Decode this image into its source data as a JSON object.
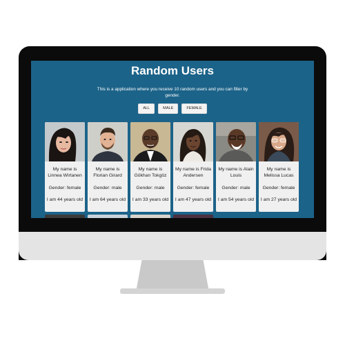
{
  "app": {
    "title": "Random Users",
    "subtitle": "This is a application where you receive 10 random users and you can filter by gender."
  },
  "filters": [
    "ALL",
    "MALE",
    "FEMALE"
  ],
  "users": [
    {
      "name": "My name is Linnea Wirtanen",
      "gender": "Gender: female",
      "age": "I am 44 years old",
      "avatar": "female-avatar"
    },
    {
      "name": "My name is Florian Girard",
      "gender": "Gender: male",
      "age": "I am 64 years old",
      "avatar": "male-avatar"
    },
    {
      "name": "My name is Gökhan Tokgöz",
      "gender": "Gender: male",
      "age": "I am 33 years old",
      "avatar": "male-avatar"
    },
    {
      "name": "My name is Frida Andersen",
      "gender": "Gender: female",
      "age": "I am 47 years old",
      "avatar": "female-avatar"
    },
    {
      "name": "My name is Alain Louis",
      "gender": "Gender: male",
      "age": "I am 54 years old",
      "avatar": "male-avatar"
    },
    {
      "name": "My name is Melissa Lucas",
      "gender": "Gender: female",
      "age": "I am 27 years old",
      "avatar": "female-avatar"
    }
  ],
  "colors": {
    "screen_bg": "#1c6389",
    "card_bg": "#f0f0f0",
    "monitor_bezel": "#0b0b0b",
    "monitor_chin": "#e4e4e4"
  }
}
